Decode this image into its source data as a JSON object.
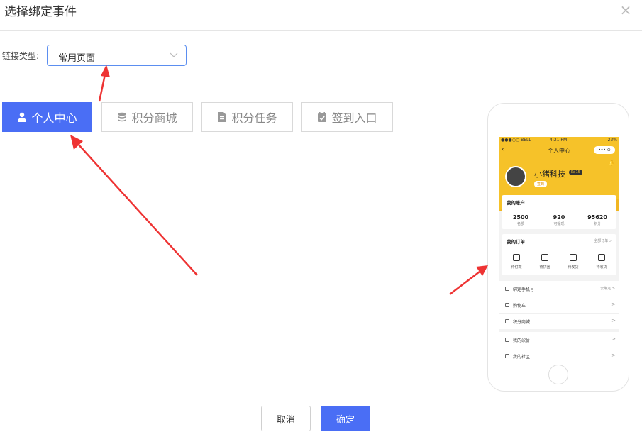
{
  "dialog": {
    "title": "选择绑定事件",
    "close_label": "×"
  },
  "link_type": {
    "label": "链接类型:",
    "value": "常用页面"
  },
  "tabs": [
    {
      "label": "个人中心",
      "icon": "user-icon",
      "active": true
    },
    {
      "label": "积分商城",
      "icon": "database-icon",
      "active": false
    },
    {
      "label": "积分任务",
      "icon": "document-icon",
      "active": false
    },
    {
      "label": "签到入口",
      "icon": "calendar-check-icon",
      "active": false
    }
  ],
  "footer": {
    "cancel": "取消",
    "confirm": "确定"
  },
  "colors": {
    "primary": "#4a6ef5",
    "arrow": "#ee3333",
    "phone_header": "#f6c229"
  },
  "phone": {
    "status": {
      "carrier": "●●●○○ BELL",
      "time": "4:21 PM",
      "battery": "22%"
    },
    "nav_title": "个人中心",
    "nav_capsule": "••• ⊙",
    "user": {
      "name": "小猪科技",
      "level": "LV.15",
      "sign": "签到"
    },
    "account": {
      "title": "我的账户",
      "stats": [
        {
          "value": "2500",
          "label": "名额"
        },
        {
          "value": "920",
          "label": "可提现"
        },
        {
          "value": "95620",
          "label": "积分"
        }
      ]
    },
    "orders": {
      "title": "我的订单",
      "more": "全部订单 >",
      "items": [
        {
          "label": "待付款"
        },
        {
          "label": "待拼团"
        },
        {
          "label": "待发货"
        },
        {
          "label": "待收货"
        }
      ]
    },
    "menu": [
      {
        "label": "绑定手机号",
        "right": "去绑定 >"
      },
      {
        "label": "购物车",
        "right": ">"
      },
      {
        "label": "积分商城",
        "right": ">"
      },
      {
        "label": "我的砍价",
        "right": ">"
      },
      {
        "label": "我的社区",
        "right": ">"
      }
    ]
  }
}
